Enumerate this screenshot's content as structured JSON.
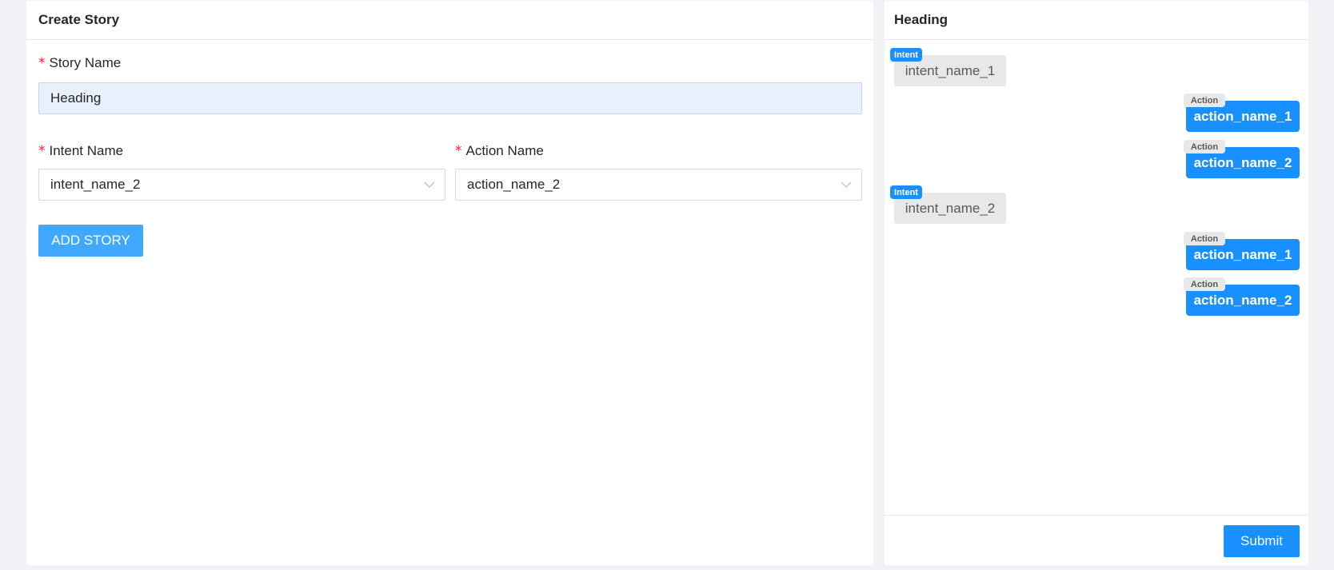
{
  "create_story": {
    "title": "Create Story",
    "story_name_label": "Story Name",
    "story_name_value": "Heading",
    "intent_label": "Intent Name",
    "intent_value": "intent_name_2",
    "action_label": "Action Name",
    "action_value": "action_name_2",
    "add_button": "ADD STORY",
    "required_mark": "*"
  },
  "preview": {
    "title": "Heading",
    "intent_tag": "Intent",
    "action_tag": "Action",
    "messages": [
      {
        "type": "intent",
        "text": "intent_name_1"
      },
      {
        "type": "action",
        "text": "action_name_1"
      },
      {
        "type": "action",
        "text": "action_name_2"
      },
      {
        "type": "intent",
        "text": "intent_name_2"
      },
      {
        "type": "action",
        "text": "action_name_1"
      },
      {
        "type": "action",
        "text": "action_name_2"
      }
    ],
    "submit_button": "Submit"
  },
  "colors": {
    "primary": "#1890ff",
    "add_button": "#40a9ff",
    "required": "#f5222d",
    "background": "#f0f2f5"
  },
  "icons": {
    "select_caret": "chevron-down-icon"
  }
}
